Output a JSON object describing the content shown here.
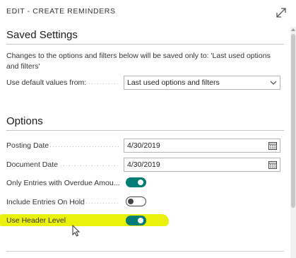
{
  "dialog": {
    "title": "EDIT - CREATE REMINDERS"
  },
  "saved_settings": {
    "heading": "Saved Settings",
    "info": "Changes to the options and filters below will be saved only to: 'Last used options and filters'",
    "default_values_label": "Use default values from:",
    "default_values_selected": "Last used options and filters"
  },
  "options": {
    "heading": "Options",
    "posting_date_label": "Posting Date",
    "posting_date_value": "4/30/2019",
    "document_date_label": "Document Date",
    "document_date_value": "4/30/2019",
    "only_overdue_label": "Only Entries with Overdue Amou...",
    "only_overdue_on": true,
    "include_on_hold_label": "Include Entries On Hold",
    "include_on_hold_on": false,
    "use_header_level_label": "Use Header Level",
    "use_header_level_on": true
  },
  "colors": {
    "toggle_on": "#007d74",
    "highlight": "#e8f000"
  },
  "icons": {
    "expand": "expand-icon",
    "chevron": "chevron-down-icon",
    "calendar": "calendar-icon",
    "cursor": "mouse-cursor-icon"
  }
}
